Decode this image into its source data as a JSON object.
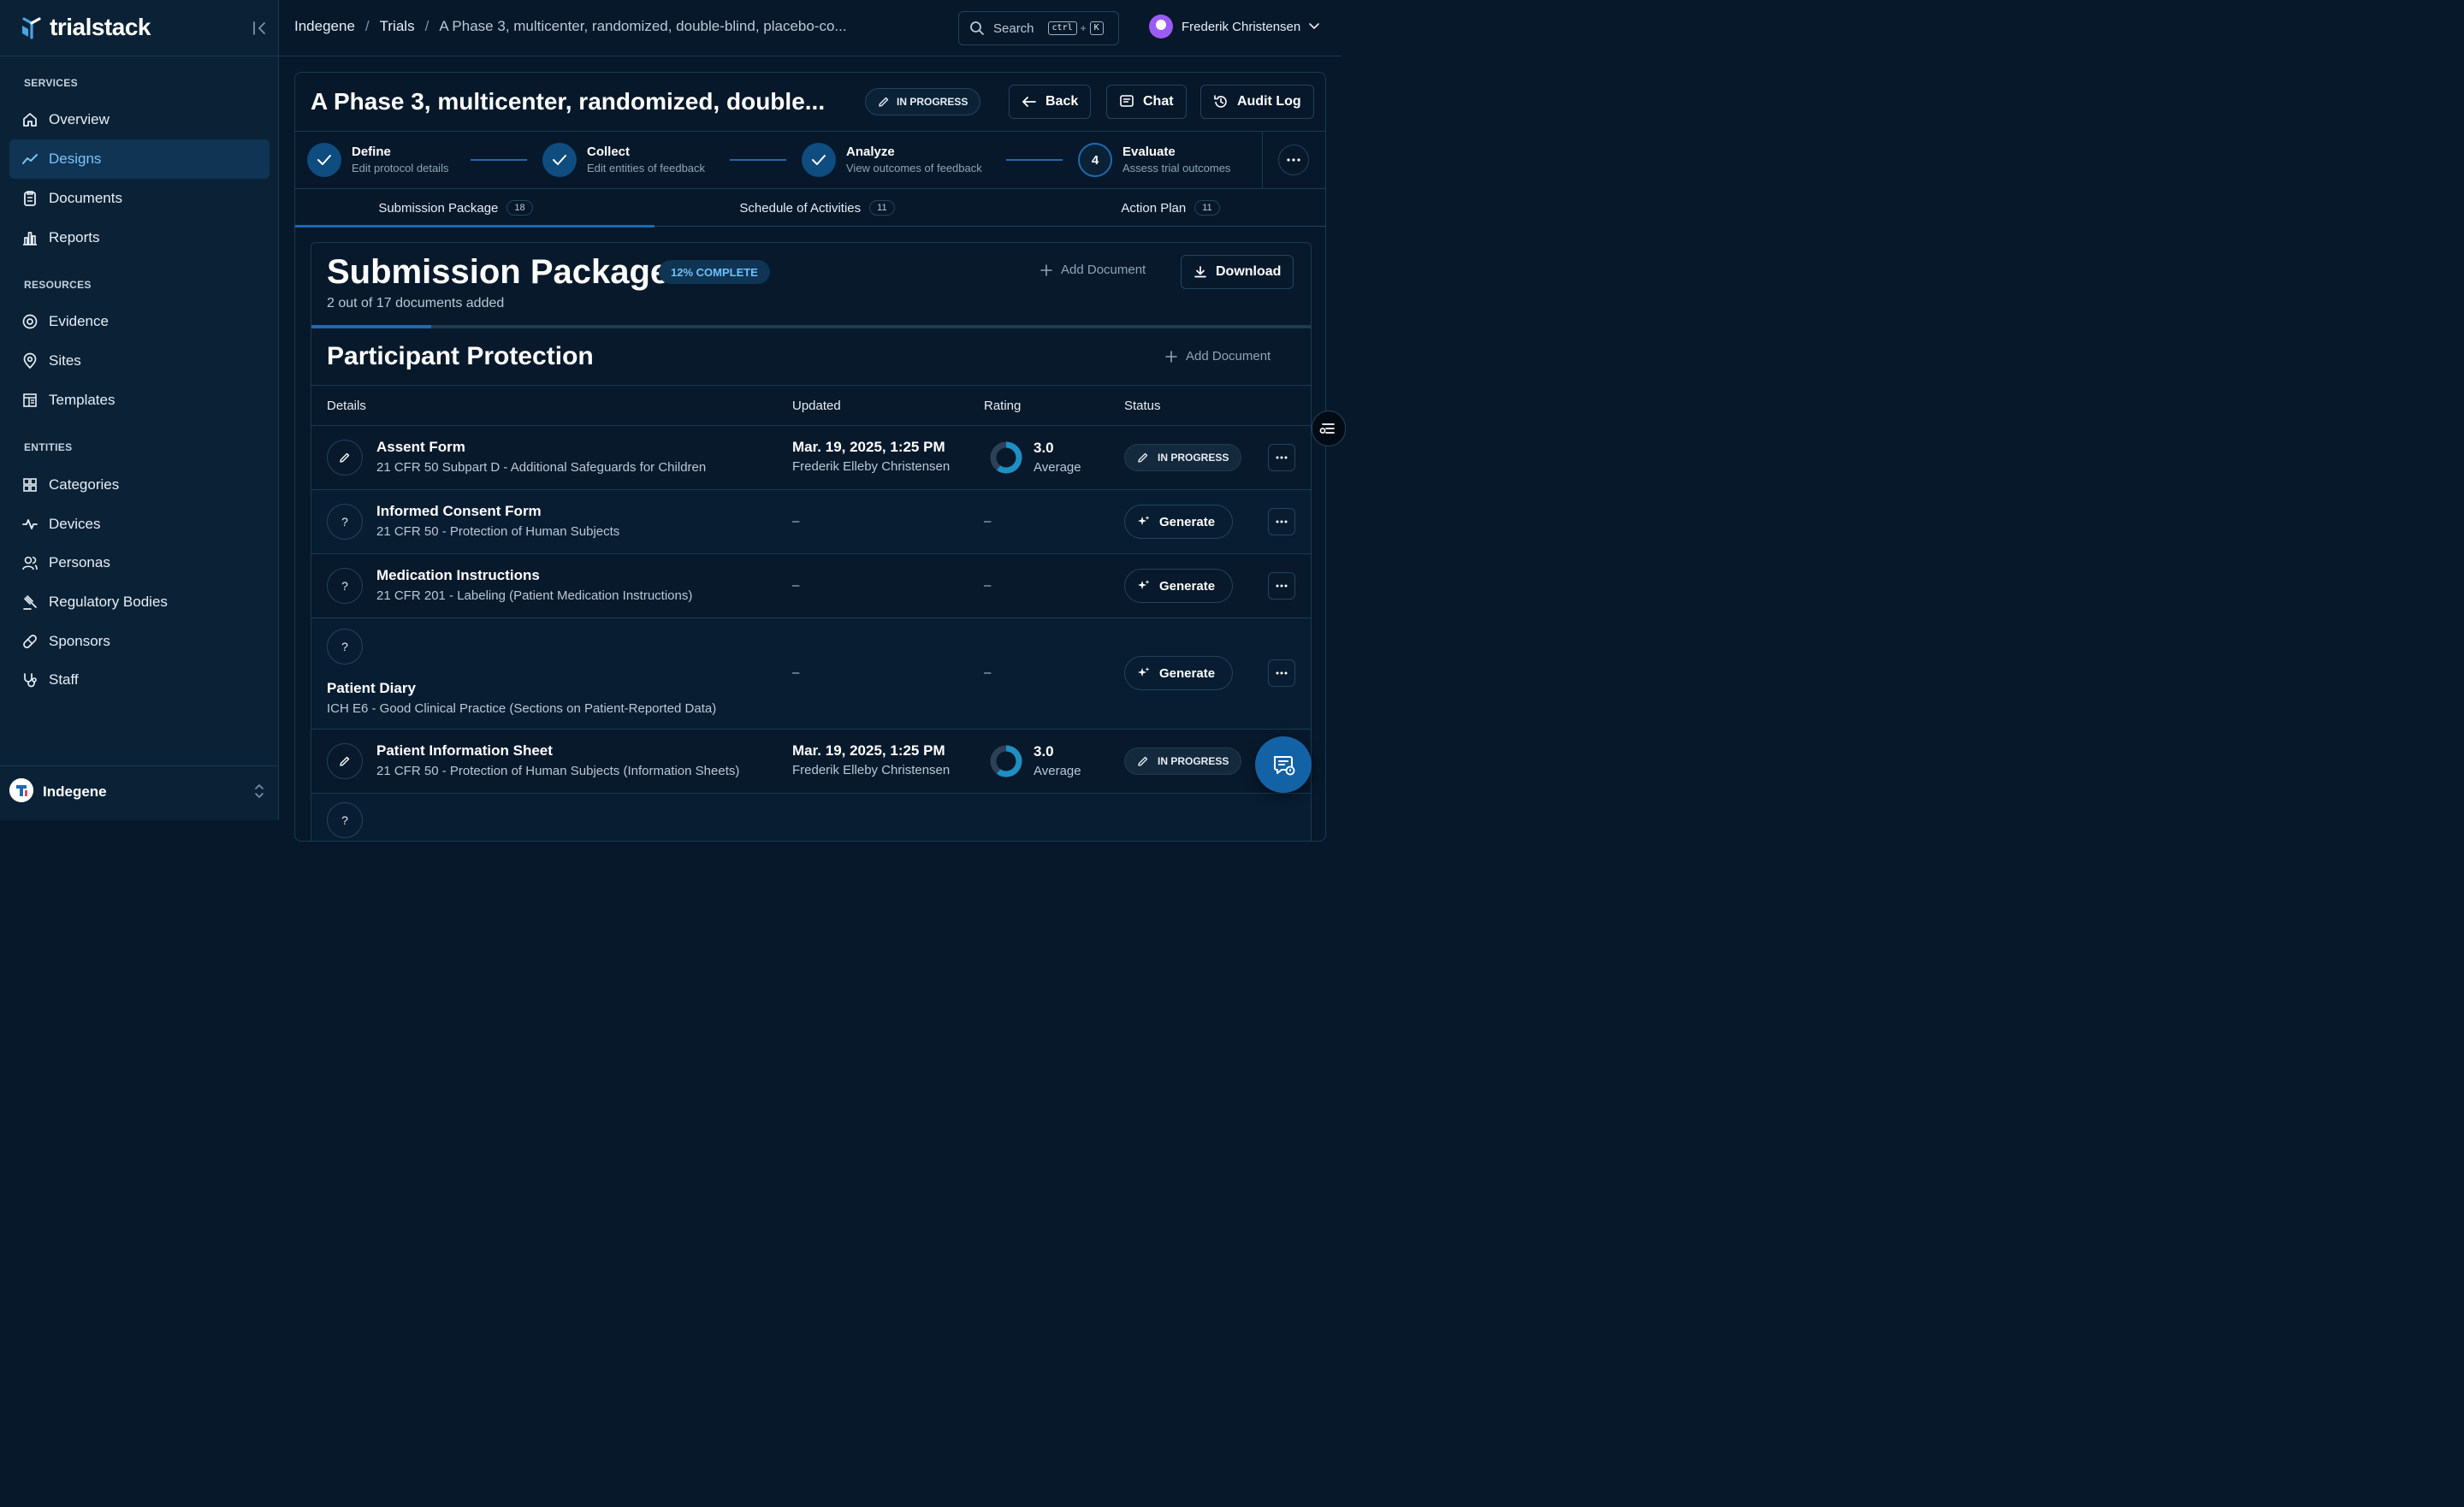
{
  "app": {
    "name": "trialstack"
  },
  "sidebar": {
    "sections": [
      {
        "label": "SERVICES",
        "items": [
          {
            "label": "Overview",
            "icon": "home-icon"
          },
          {
            "label": "Designs",
            "icon": "trend-icon",
            "active": true
          },
          {
            "label": "Documents",
            "icon": "clipboard-icon"
          },
          {
            "label": "Reports",
            "icon": "bar-chart-icon"
          }
        ]
      },
      {
        "label": "RESOURCES",
        "items": [
          {
            "label": "Evidence",
            "icon": "eye-scan-icon"
          },
          {
            "label": "Sites",
            "icon": "map-pin-icon"
          },
          {
            "label": "Templates",
            "icon": "template-icon"
          }
        ]
      },
      {
        "label": "ENTITIES",
        "items": [
          {
            "label": "Categories",
            "icon": "grid-icon"
          },
          {
            "label": "Devices",
            "icon": "pulse-icon"
          },
          {
            "label": "Personas",
            "icon": "users-icon"
          },
          {
            "label": "Regulatory Bodies",
            "icon": "gavel-icon"
          },
          {
            "label": "Sponsors",
            "icon": "pill-icon"
          },
          {
            "label": "Staff",
            "icon": "stethoscope-icon"
          }
        ]
      }
    ],
    "org": {
      "name": "Indegene"
    }
  },
  "topbar": {
    "breadcrumb": [
      "Indegene",
      "Trials",
      "A Phase 3, multicenter, randomized, double-blind, placebo-co..."
    ],
    "search": {
      "placeholder": "Search",
      "kbd1": "ctrl",
      "kbd2": "K"
    },
    "user": {
      "name": "Frederik Christensen"
    }
  },
  "trial": {
    "title": "A Phase 3, multicenter, randomized, double...",
    "status": "IN PROGRESS",
    "actions": {
      "back": "Back",
      "chat": "Chat",
      "audit": "Audit Log"
    },
    "steps": [
      {
        "title": "Define",
        "sub": "Edit protocol details",
        "done": true
      },
      {
        "title": "Collect",
        "sub": "Edit entities of feedback",
        "done": true
      },
      {
        "title": "Analyze",
        "sub": "View outcomes of feedback",
        "done": true
      },
      {
        "number": "4",
        "title": "Evaluate",
        "sub": "Assess trial outcomes",
        "done": false
      }
    ],
    "tabs": [
      {
        "label": "Submission Package",
        "count": "18",
        "active": true
      },
      {
        "label": "Schedule of Activities",
        "count": "11"
      },
      {
        "label": "Action Plan",
        "count": "11"
      }
    ]
  },
  "submission": {
    "title": "Submission Package",
    "complete_badge": "12% COMPLETE",
    "progress": 0.12,
    "subtitle": "2 out of 17 documents added",
    "add_document": "Add Document",
    "download": "Download",
    "section": {
      "title": "Participant Protection",
      "add_document": "Add Document",
      "columns": [
        "Details",
        "Updated",
        "Rating",
        "Status"
      ],
      "rows": [
        {
          "icon": "pencil-icon",
          "name": "Assent Form",
          "regulation": "21 CFR 50 Subpart D - Additional Safeguards for Children",
          "updated": "Mar. 19, 2025, 1:25 PM",
          "updated_by": "Frederik Elleby Christensen",
          "rating": "3.0",
          "rating_label": "Average",
          "rating_fraction": 0.6,
          "status": "IN PROGRESS"
        },
        {
          "icon": "question-icon",
          "icon_text": "?",
          "name": "Informed Consent Form",
          "regulation": "21 CFR 50 - Protection of Human Subjects",
          "updated": "–",
          "rating": "–",
          "action": "Generate"
        },
        {
          "icon": "question-icon",
          "icon_text": "?",
          "name": "Medication Instructions",
          "regulation": "21 CFR 201 - Labeling (Patient Medication Instructions)",
          "updated": "–",
          "rating": "–",
          "action": "Generate"
        },
        {
          "icon": "question-icon",
          "icon_text": "?",
          "name": "Patient Diary",
          "regulation": "ICH E6 - Good Clinical Practice (Sections on Patient-Reported Data)",
          "updated": "–",
          "rating": "–",
          "action": "Generate"
        },
        {
          "icon": "pencil-icon",
          "name": "Patient Information Sheet",
          "regulation": "21 CFR 50 - Protection of Human Subjects (Information Sheets)",
          "updated": "Mar. 19, 2025, 1:25 PM",
          "updated_by": "Frederik Elleby Christensen",
          "rating": "3.0",
          "rating_label": "Average",
          "rating_fraction": 0.6,
          "status": "IN PROGRESS"
        },
        {
          "icon": "question-icon",
          "icon_text": "?"
        }
      ]
    }
  },
  "colors": {
    "accent": "#1e6ab0",
    "background": "#06182a",
    "sidebar": "#0b2236"
  }
}
